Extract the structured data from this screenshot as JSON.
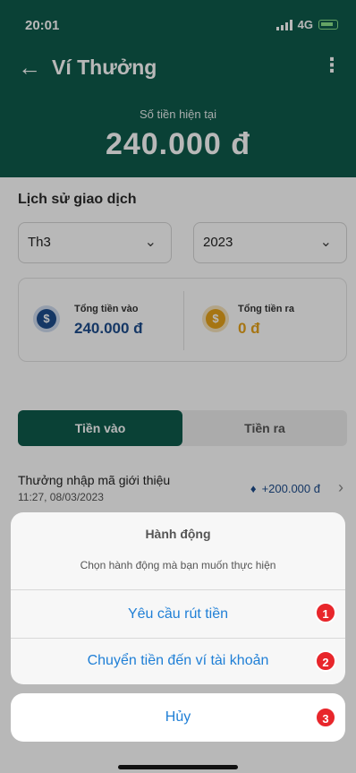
{
  "status_bar": {
    "time": "20:01",
    "network": "4G"
  },
  "header": {
    "title": "Ví Thưởng",
    "back_icon": "arrow-left-icon",
    "more_icon": "more-vertical-icon",
    "balance_label": "Số tiền hiện tại",
    "balance_value": "240.000 đ"
  },
  "history": {
    "title": "Lịch sử giao dịch",
    "month_select": "Th3",
    "year_select": "2023",
    "total_in_label": "Tổng tiền vào",
    "total_in_value": "240.000 đ",
    "total_out_label": "Tổng tiền ra",
    "total_out_value": "0 đ"
  },
  "tabs": {
    "in_label": "Tiền vào",
    "out_label": "Tiền ra",
    "active": "in"
  },
  "transactions": [
    {
      "title": "Thưởng nhập mã giới thiệu",
      "time": "11:27, 08/03/2023",
      "amount": "+200.000 đ",
      "icon": "diamond-icon"
    }
  ],
  "action_sheet": {
    "title": "Hành động",
    "subtitle": "Chọn hành động mà bạn muốn thực hiện",
    "actions": [
      {
        "label": "Yêu cầu rút tiền",
        "badge": "1"
      },
      {
        "label": "Chuyển tiền đến ví tài khoản",
        "badge": "2"
      }
    ],
    "cancel_label": "Hủy",
    "cancel_badge": "3"
  },
  "colors": {
    "brand": "#0f5a4c",
    "link": "#1f7fd6",
    "badge": "#e8262b",
    "in_value": "#1e4d8c",
    "out_value": "#e6a21b"
  }
}
